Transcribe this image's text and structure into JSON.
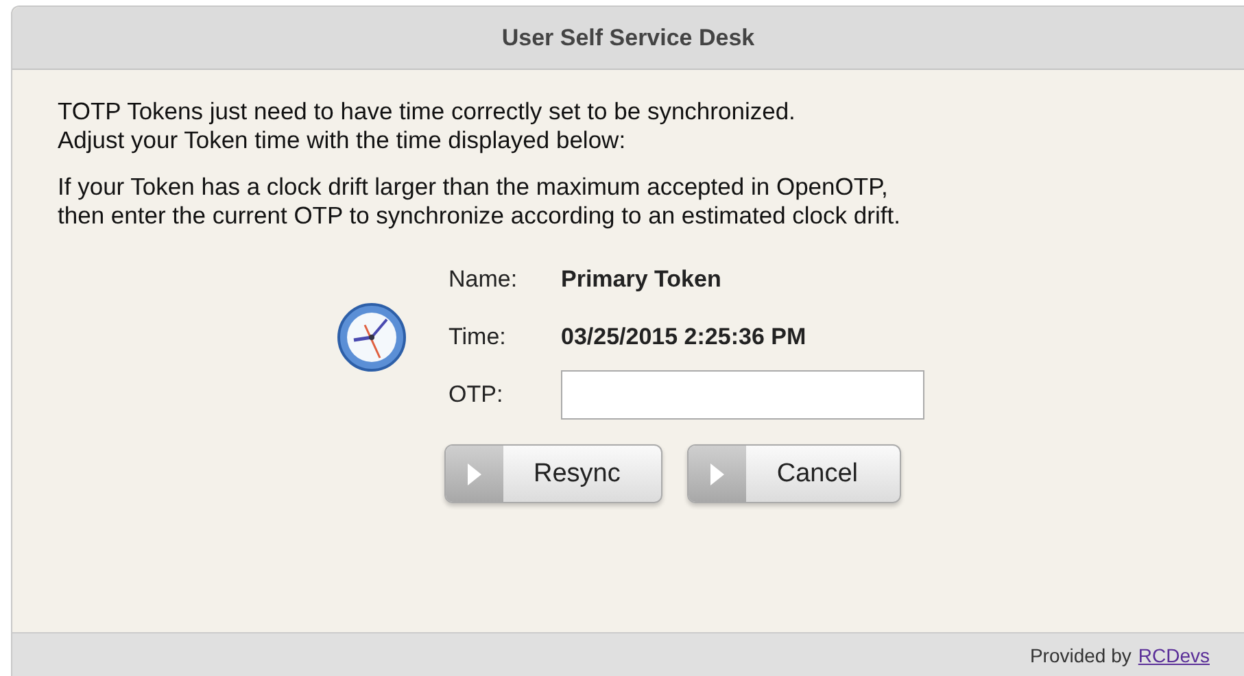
{
  "window": {
    "title": "User Self Service Desk"
  },
  "paragraphs": [
    "TOTP Tokens just need to have time correctly set to be synchronized.\nAdjust your Token time with the time displayed below:",
    "If your Token has a clock drift larger than the maximum accepted in OpenOTP,\nthen enter the current OTP to synchronize according to an estimated clock drift."
  ],
  "fields": [
    {
      "kind": "text",
      "label": "Name:",
      "value": "Primary Token"
    },
    {
      "kind": "text",
      "label": "Time:",
      "value": "03/25/2015 2:25:36 PM"
    },
    {
      "kind": "input",
      "label": "OTP:"
    }
  ],
  "buttons": [
    "Resync",
    "Cancel"
  ],
  "footer": {
    "text": "Provided by",
    "link": "RCDevs"
  }
}
